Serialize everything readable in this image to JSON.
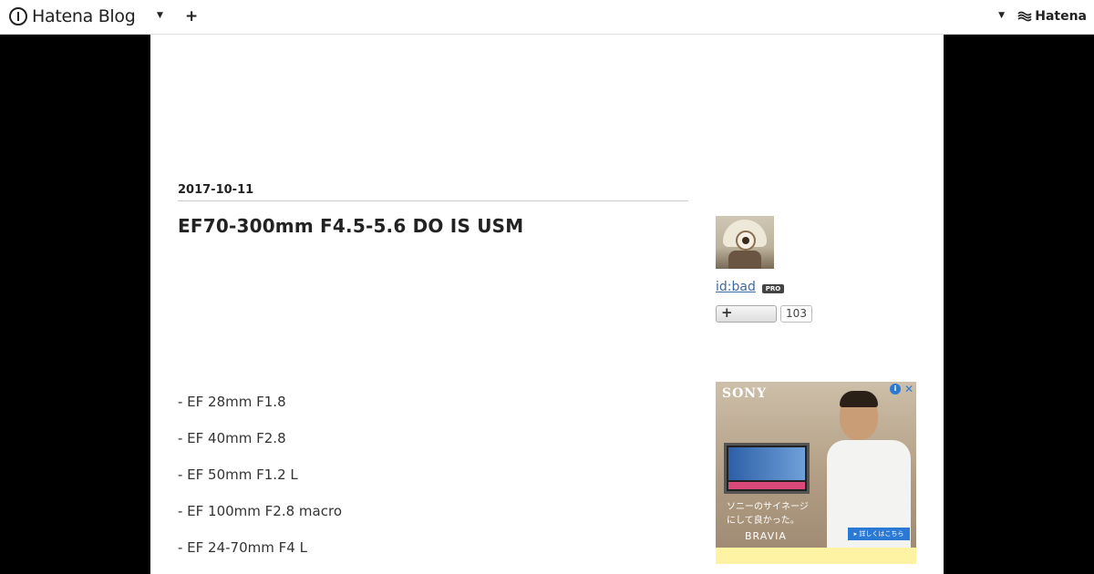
{
  "header": {
    "brand": "Hatena Blog",
    "plus_symbol": "+",
    "hatena_logo": "Hatena",
    "caret_icon": "caret-down-icon"
  },
  "entry": {
    "date": "2017-10-11",
    "title": "EF70-300mm F4.5-5.6 DO IS USM",
    "items": [
      "- EF 28mm F1.8",
      "- EF 40mm F2.8",
      "- EF 50mm F1.2 L",
      "- EF 100mm F2.8 macro",
      "- EF 24-70mm F4 L"
    ]
  },
  "profile": {
    "id": "id:bad",
    "badge": "PRO",
    "follow_symbol": "+",
    "follow_count": "103"
  },
  "ad": {
    "brand": "SONY",
    "copy_line1": "ソニーのサイネージ",
    "copy_line2": "にして良かった。",
    "product": "BRAVIA",
    "cta": "▸ 詳しくはこちら",
    "info_icon": "info-icon",
    "close_icon": "close-icon"
  }
}
